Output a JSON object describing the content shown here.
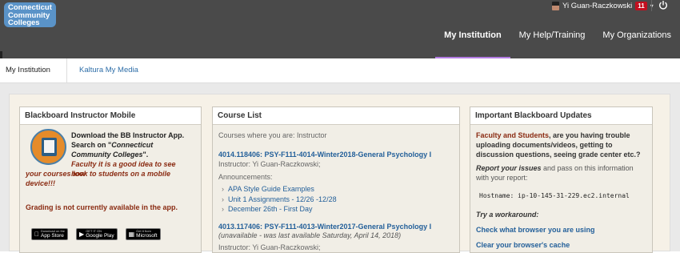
{
  "header": {
    "logo_text": "Connecticut Community Colleges",
    "user_name": "Yi Guan-Raczkowski",
    "notification_count": "11",
    "nav": [
      {
        "label": "My Institution",
        "active": true
      },
      {
        "label": "My Help/Training",
        "active": false
      },
      {
        "label": "My Organizations",
        "active": false
      }
    ],
    "active_color": "#b37be3"
  },
  "tabs": [
    {
      "label": "My Institution"
    },
    {
      "label": "Kaltura My Media"
    }
  ],
  "modules": {
    "instructor_mobile": {
      "title": "Blackboard Instructor Mobile",
      "download_text": "Download the BB Instructor App. Search on \"",
      "search_term": "Connecticut Community Colleges",
      "download_end": "\".",
      "tip_start": "Faculty it is a good idea to see how",
      "tip_end": "your courses look to students on a mobile device!!!",
      "grading_note": "Grading is not currently available in the app.",
      "stores": [
        {
          "small": "Download on the",
          "label": "App Store",
          "icon": "apple-icon"
        },
        {
          "small": "GET IT ON",
          "label": "Google Play",
          "icon": "google-play-icon"
        },
        {
          "small": "Get it from",
          "label": "Microsoft",
          "icon": "microsoft-icon"
        }
      ]
    },
    "course_list": {
      "title": "Course List",
      "where_label": "Courses where you are: Instructor",
      "courses": [
        {
          "link": "4014.118406: PSY-F111-4014-Winter2018-General Psychology I",
          "instructor": "Instructor: Yi Guan-Raczkowski;",
          "announcements_label": "Announcements:",
          "announcements": [
            "APA Style Guide Examples",
            "Unit 1 Assignments - 12/26 -12/28",
            "December 26th - First Day"
          ]
        },
        {
          "link": "4013.117406: PSY-F111-4013-Winter2017-General Psychology I",
          "unavailable": "(unavailable - was last available Saturday, April 14, 2018)",
          "instructor": "Instructor: Yi Guan-Raczkowski;"
        }
      ]
    },
    "updates": {
      "title": "Important Blackboard Updates",
      "highlight": "Faculty and Students",
      "question": ", are you having trouble uploading documents/videos, getting to discussion questions, seeing grade center etc.?",
      "report_bold": "Report your issues",
      "report_rest": " and pass on this information with your report:",
      "hostname": "Hostname: ip-10-145-31-229.ec2.internal",
      "try_label": "Try a workaround:",
      "links": [
        "Check what browser you are using",
        "Clear your browser's cache"
      ]
    }
  }
}
